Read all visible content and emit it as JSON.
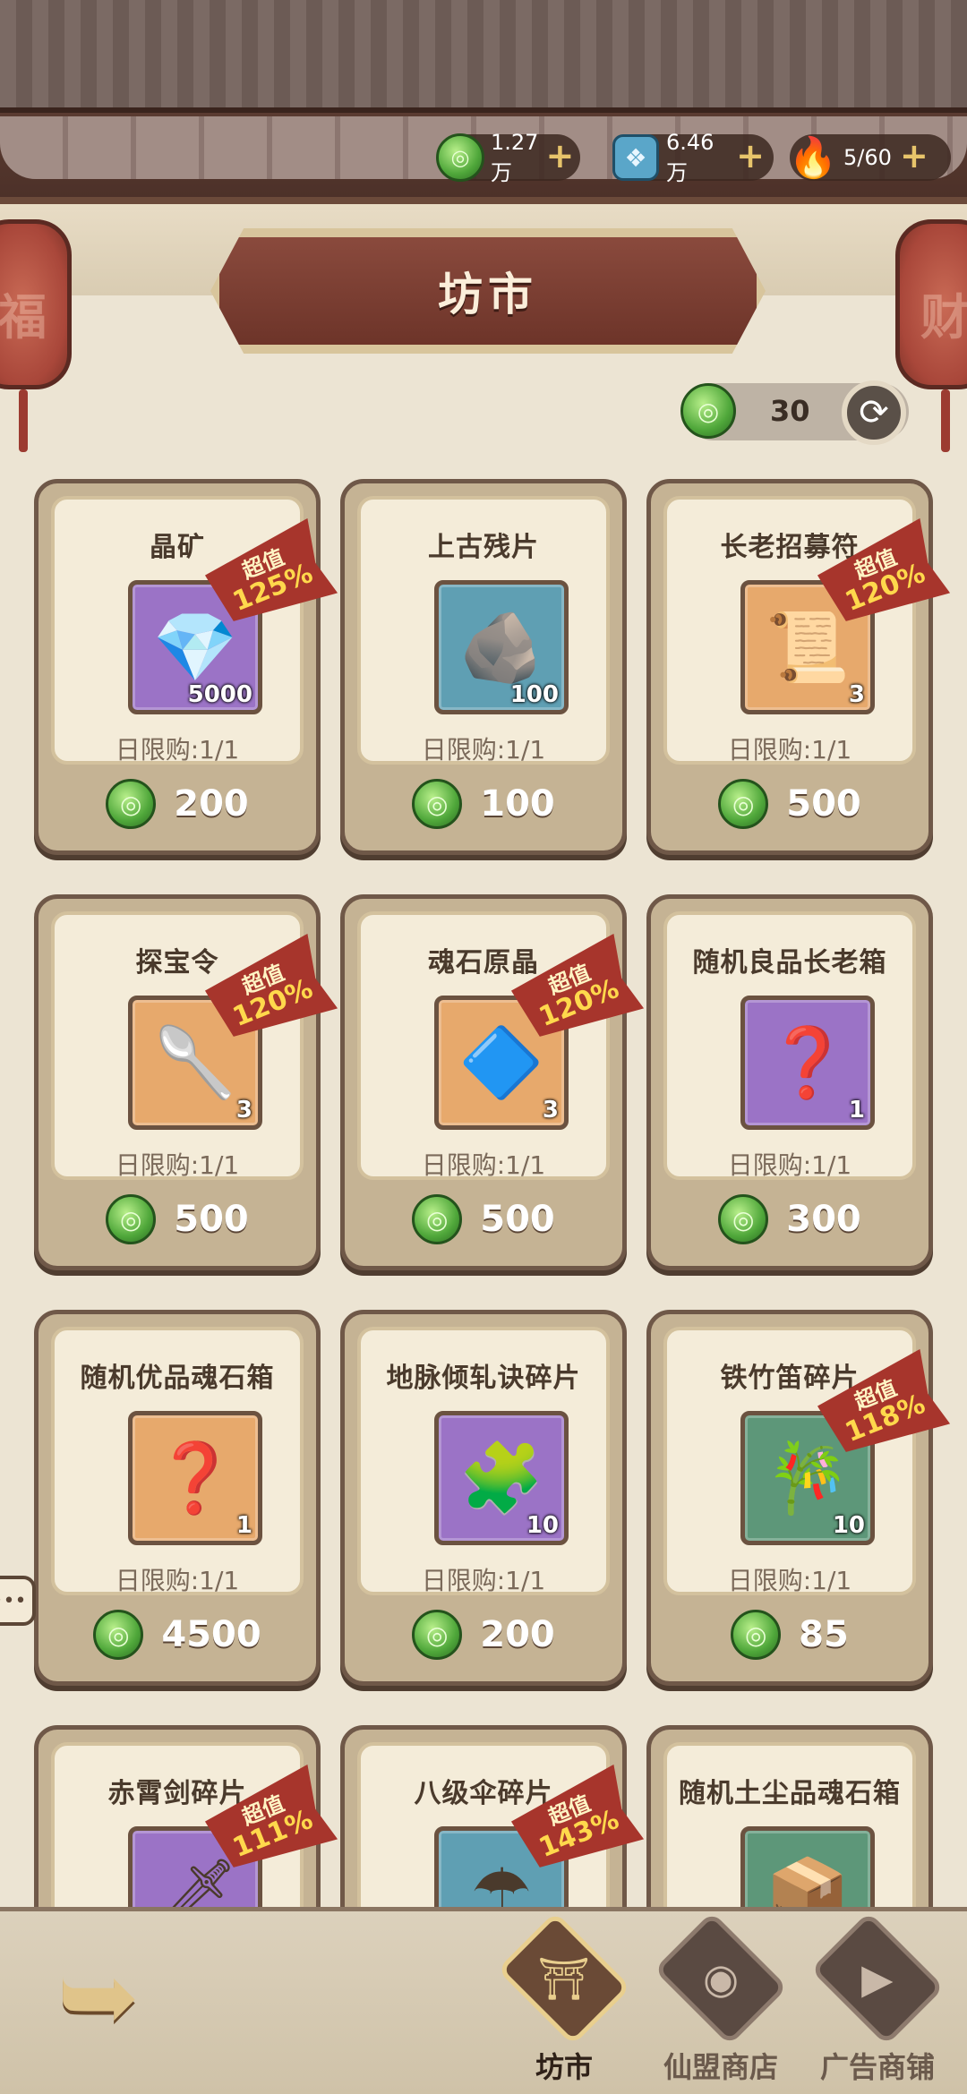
{
  "header": {
    "title": "坊市",
    "lantern_left_char": "福",
    "lantern_right_char": "财"
  },
  "currencies": {
    "jade": {
      "value": "1.27万",
      "icon": "jade-coin-icon"
    },
    "crystal": {
      "value": "6.46万",
      "icon": "blue-crystal-icon"
    },
    "stamina": {
      "value": "5/60",
      "icon": "flame-icon"
    }
  },
  "refresh": {
    "count": "30",
    "icon": "refresh-icon"
  },
  "items": [
    {
      "name": "晶矿",
      "qty": "5000",
      "limit": "日限购:1/1",
      "price": "200",
      "frame": "purple",
      "badge": true,
      "badge_top": "超值",
      "badge_pct": "125%",
      "glyph": "💎"
    },
    {
      "name": "上古残片",
      "qty": "100",
      "limit": "日限购:1/1",
      "price": "100",
      "frame": "blue",
      "badge": false,
      "glyph": "🪨"
    },
    {
      "name": "长老招募符",
      "qty": "3",
      "limit": "日限购:1/1",
      "price": "500",
      "frame": "orange",
      "badge": true,
      "badge_top": "超值",
      "badge_pct": "120%",
      "glyph": "📜"
    },
    {
      "name": "探宝令",
      "qty": "3",
      "limit": "日限购:1/1",
      "price": "500",
      "frame": "orange",
      "badge": true,
      "badge_top": "超值",
      "badge_pct": "120%",
      "glyph": "🥄"
    },
    {
      "name": "魂石原晶",
      "qty": "3",
      "limit": "日限购:1/1",
      "price": "500",
      "frame": "orange",
      "badge": true,
      "badge_top": "超值",
      "badge_pct": "120%",
      "glyph": "🔷"
    },
    {
      "name": "随机良品长老箱",
      "qty": "1",
      "limit": "日限购:1/1",
      "price": "300",
      "frame": "purple",
      "badge": false,
      "glyph": "❓"
    },
    {
      "name": "随机优品魂石箱",
      "qty": "1",
      "limit": "日限购:1/1",
      "price": "4500",
      "frame": "orange",
      "badge": false,
      "glyph": "❓"
    },
    {
      "name": "地脉倾轧诀碎片",
      "qty": "10",
      "limit": "日限购:1/1",
      "price": "200",
      "frame": "purple",
      "badge": false,
      "glyph": "🧩"
    },
    {
      "name": "铁竹笛碎片",
      "qty": "10",
      "limit": "日限购:1/1",
      "price": "85",
      "frame": "green",
      "badge": true,
      "badge_top": "超值",
      "badge_pct": "118%",
      "glyph": "🎋"
    },
    {
      "name": "赤霄剑碎片",
      "qty": "",
      "limit": "",
      "price": "",
      "frame": "purple",
      "badge": true,
      "badge_top": "超值",
      "badge_pct": "111%",
      "glyph": "🗡"
    },
    {
      "name": "八级伞碎片",
      "qty": "",
      "limit": "",
      "price": "",
      "frame": "blue",
      "badge": true,
      "badge_top": "超值",
      "badge_pct": "143%",
      "glyph": "☂"
    },
    {
      "name": "随机土尘品魂石箱",
      "qty": "",
      "limit": "",
      "price": "",
      "frame": "green",
      "badge": false,
      "glyph": "📦"
    }
  ],
  "nav": {
    "tabs": [
      {
        "label": "坊市",
        "icon": "pagoda-icon",
        "active": true
      },
      {
        "label": "仙盟商店",
        "icon": "alliance-coin-icon",
        "active": false
      },
      {
        "label": "广告商铺",
        "icon": "video-play-icon",
        "active": false
      }
    ],
    "back_icon": "back-arrow-icon"
  }
}
